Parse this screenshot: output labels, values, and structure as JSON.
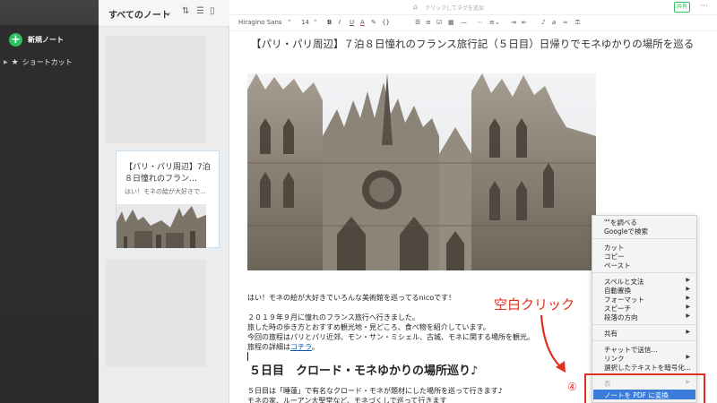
{
  "sidebar": {
    "new_note_label": "新規ノート",
    "shortcut_label": "ショートカット"
  },
  "notes_list": {
    "header_title": "すべてのノート",
    "card": {
      "title": "【パリ・パリ周辺】7泊８日憧れのフラン…",
      "snippet": "はい！モネの絵が大好きで…"
    }
  },
  "editor": {
    "tag_placeholder": "クリックしてタグを追加",
    "share_label": "共有",
    "toolbar": {
      "font_family": "Hiragino Sans",
      "font_size": "14"
    },
    "title": "【パリ・パリ周辺】７泊８日憧れのフランス旅行記（５日目）日帰りでモネゆかりの場所を巡る",
    "paragraph1": "はい！モネの絵が大好きでいろんな美術館を巡ってるnicoです！",
    "paragraph2_line1": "２０１９年９月に憧れのフランス旅行へ行きました。",
    "paragraph2_line2": "旅した時の歩き方とおすすめ観光地・見どころ、食べ物を紹介しています。",
    "paragraph2_line3": "今回の旅程はパリとパリ近郊、モン・サン・ミシェル、古城、モネに関する場所を観光。",
    "details_prefix": "旅程の詳細は",
    "details_link": "コチラ",
    "details_suffix": "。",
    "heading": "５日目　クロード・モネゆかりの場所巡り♪",
    "paragraph3": "５日目は「睡蓮」で有名なクロード・モネが題材にした場所を巡って行きます♪",
    "paragraph4": "モネの家、ルーアン大聖堂など、モネづくしで巡って行きます"
  },
  "annotation": {
    "label": "空白クリック",
    "number": "④"
  },
  "context_menu": {
    "items": [
      "\"\"を調べる",
      "Googleで検索",
      "カット",
      "コピー",
      "ペースト",
      "スペルと文法",
      "自動置換",
      "フォーマット",
      "スピーチ",
      "段落の方向",
      "共有",
      "チャットで送信...",
      "リンク",
      "選択したテキストを暗号化...",
      "表",
      "ノートを PDF に変換"
    ]
  }
}
